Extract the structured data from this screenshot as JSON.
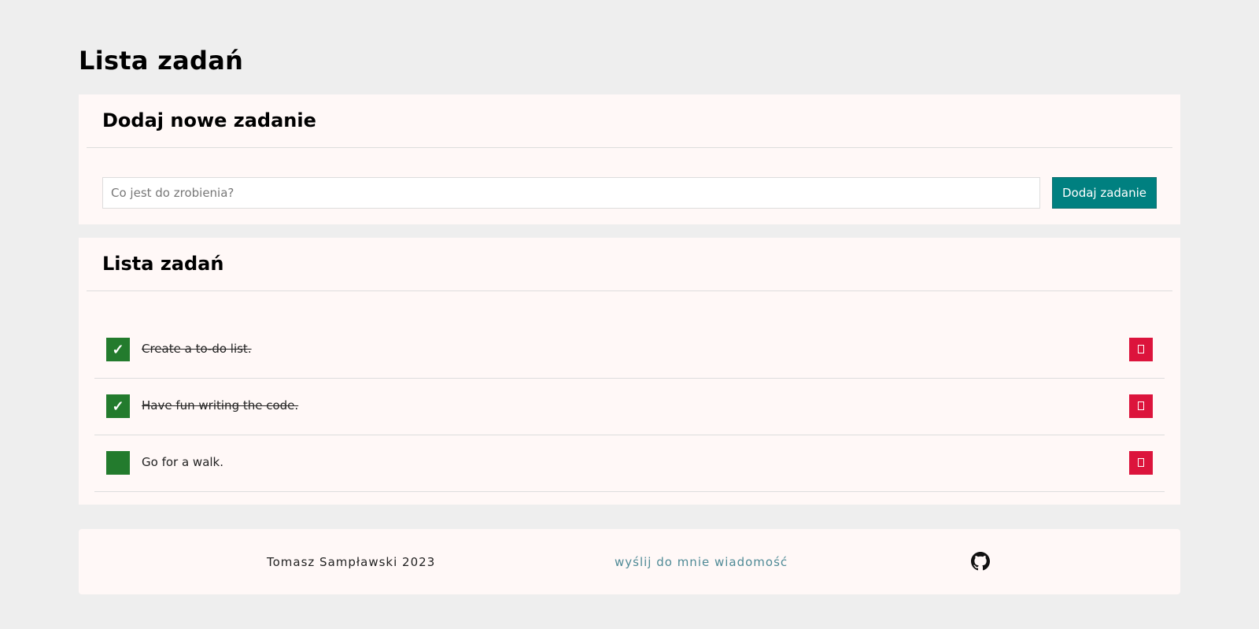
{
  "page": {
    "title": "Lista zadań"
  },
  "add_section": {
    "title": "Dodaj nowe zadanie",
    "input_value": "",
    "input_placeholder": "Co jest do zrobienia?",
    "button_label": "Dodaj zadanie"
  },
  "list_section": {
    "title": "Lista zadań",
    "tasks": [
      {
        "text": "Create a to-do list.",
        "done": true,
        "check_mark": "✓",
        "delete_icon": "trash-icon"
      },
      {
        "text": "Have fun writing the code.",
        "done": true,
        "check_mark": "✓",
        "delete_icon": "trash-icon"
      },
      {
        "text": "Go for a walk.",
        "done": false,
        "check_mark": "",
        "delete_icon": "trash-icon"
      }
    ]
  },
  "footer": {
    "author": "Tomasz Sampławski 2023",
    "contact_label": "wyślij do mnie wiadomość",
    "github_icon": "github-icon"
  },
  "colors": {
    "page_background": "#eeeeee",
    "panel_background": "#fff8f7",
    "accent_teal": "#008080",
    "done_green": "#237b2d",
    "delete_red": "#dc143c",
    "link_color": "#4f8a96"
  }
}
